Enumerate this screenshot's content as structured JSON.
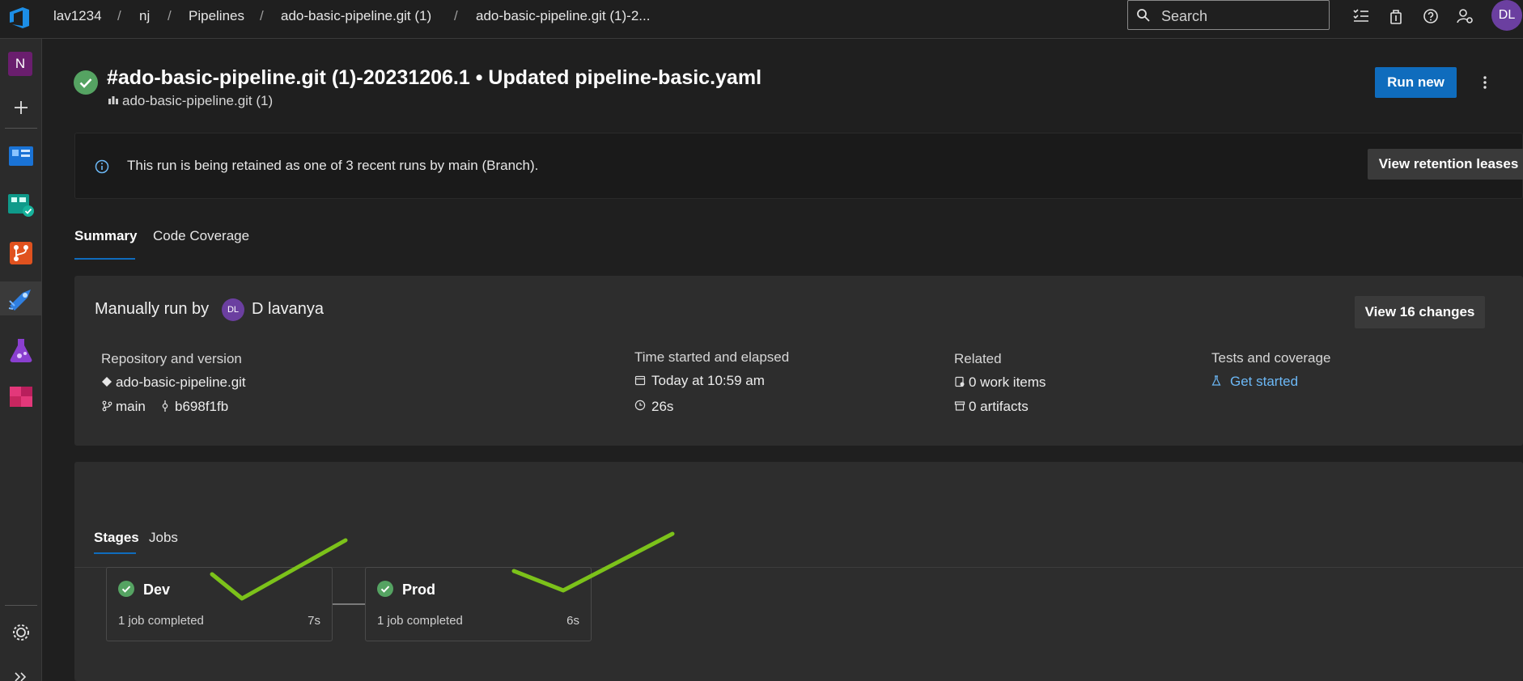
{
  "breadcrumb": [
    "lav1234",
    "nj",
    "Pipelines",
    "ado-basic-pipeline.git (1)",
    "ado-basic-pipeline.git (1)-2..."
  ],
  "search": {
    "placeholder": "Search"
  },
  "user": {
    "initials": "DL"
  },
  "nav": {
    "project_initial": "N"
  },
  "run": {
    "title": "#ado-basic-pipeline.git (1)-20231206.1 • Updated pipeline-basic.yaml",
    "pipeline_name": "ado-basic-pipeline.git (1)",
    "run_new_label": "Run new"
  },
  "retention": {
    "message": "This run is being retained as one of 3 recent runs by main (Branch).",
    "button": "View retention leases"
  },
  "tabs": [
    "Summary",
    "Code Coverage"
  ],
  "summary": {
    "manually_run_by": "Manually run by",
    "user_initials": "DL",
    "user_name": "D lavanya",
    "view_changes": "View 16 changes",
    "repo_label": "Repository and version",
    "repo_name": "ado-basic-pipeline.git",
    "branch": "main",
    "commit": "b698f1fb",
    "time_label": "Time started and elapsed",
    "started": "Today at 10:59 am",
    "elapsed": "26s",
    "related_label": "Related",
    "work_items": "0 work items",
    "artifacts": "0 artifacts",
    "tests_label": "Tests and coverage",
    "get_started": "Get started"
  },
  "stages_tabs": [
    "Stages",
    "Jobs"
  ],
  "stages": [
    {
      "name": "Dev",
      "status": "1 job completed",
      "duration": "7s"
    },
    {
      "name": "Prod",
      "status": "1 job completed",
      "duration": "6s"
    }
  ],
  "colors": {
    "accent": "#0f6cbd",
    "success": "#55a362",
    "annotation": "#7cc21a",
    "link": "#6cb8f6"
  }
}
